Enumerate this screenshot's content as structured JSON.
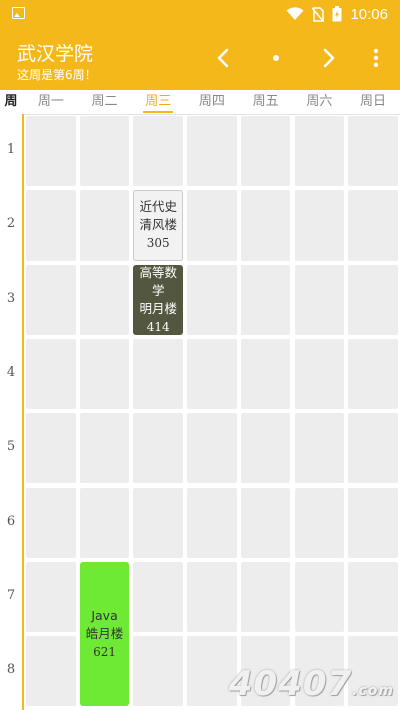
{
  "status_bar": {
    "time": "10:06",
    "icons": [
      "image-icon",
      "wifi-icon",
      "no-sim-icon",
      "battery-charging-icon"
    ]
  },
  "app_bar": {
    "title": "武汉学院",
    "subtitle": "这周是第6周！",
    "prev_icon": "chevron-left-icon",
    "dot_icon": "dot-icon",
    "next_icon": "chevron-right-icon",
    "menu_icon": "more-vert-icon"
  },
  "week_header": {
    "corner": "周",
    "days": [
      "周一",
      "周二",
      "周三",
      "周四",
      "周五",
      "周六",
      "周日"
    ],
    "active_day_index": 2
  },
  "periods": [
    "1",
    "2",
    "3",
    "4",
    "5",
    "6",
    "7",
    "8"
  ],
  "courses": [
    {
      "name": "近代史",
      "room": "清风楼",
      "number": "305",
      "day": 3,
      "start": 2,
      "span": 1,
      "style": "light"
    },
    {
      "name": "高等数学",
      "room": "明月楼",
      "number": "414",
      "day": 3,
      "start": 3,
      "span": 1,
      "style": "dark"
    },
    {
      "name": "Java",
      "room": "皓月楼",
      "number": "621",
      "day": 2,
      "start": 7,
      "span": 2,
      "style": "green"
    }
  ],
  "colors": {
    "accent": "#f5b81b",
    "active_day": "#f0a91e",
    "dark_course": "#54573f",
    "green_course": "#6eea35"
  },
  "watermark": {
    "main": "40407",
    "suffix": ".com"
  }
}
